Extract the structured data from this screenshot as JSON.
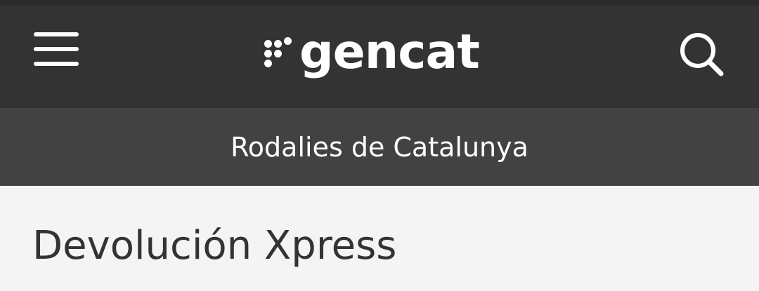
{
  "header": {
    "menu_icon": "hamburger-menu-icon",
    "logo_text": "gencat",
    "search_icon": "magnifier-search-icon",
    "background_color": "#333333"
  },
  "subheader": {
    "title": "Rodalies de Catalunya",
    "background_color": "#424242"
  },
  "main": {
    "page_title": "Devolución Xpress",
    "background_color": "#f4f4f4"
  }
}
